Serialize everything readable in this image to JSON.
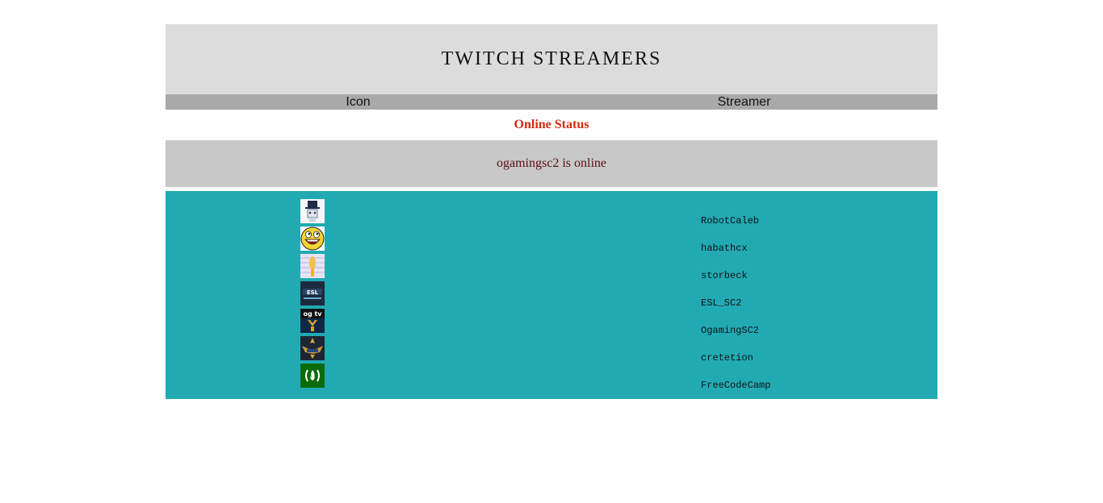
{
  "header": {
    "title": "TWITCH STREAMERS"
  },
  "columns": {
    "icon": "Icon",
    "streamer": "Streamer"
  },
  "status": {
    "heading": "Online Status",
    "message": "ogamingsc2 is online"
  },
  "streamers": [
    {
      "name": "RobotCaleb",
      "icon": "top-hat-robot-icon"
    },
    {
      "name": "habathcx",
      "icon": "awesome-face-icon"
    },
    {
      "name": "storbeck",
      "icon": "striped-figure-icon"
    },
    {
      "name": "ESL_SC2",
      "icon": "esl-logo-icon",
      "icon_text": "ESL"
    },
    {
      "name": "OgamingSC2",
      "icon": "ogtv-logo-icon",
      "icon_text": "og tv"
    },
    {
      "name": "cretetion",
      "icon": "winged-badge-icon"
    },
    {
      "name": "FreeCodeCamp",
      "icon": "freecodecamp-logo-icon",
      "icon_text": "(🔥)"
    }
  ],
  "colors": {
    "header_bg": "#dcdcdc",
    "columns_bg": "#a9a9a9",
    "status_heading": "#d22a12",
    "online_box_bg": "#c8c8c8",
    "list_bg": "#22aab3"
  }
}
